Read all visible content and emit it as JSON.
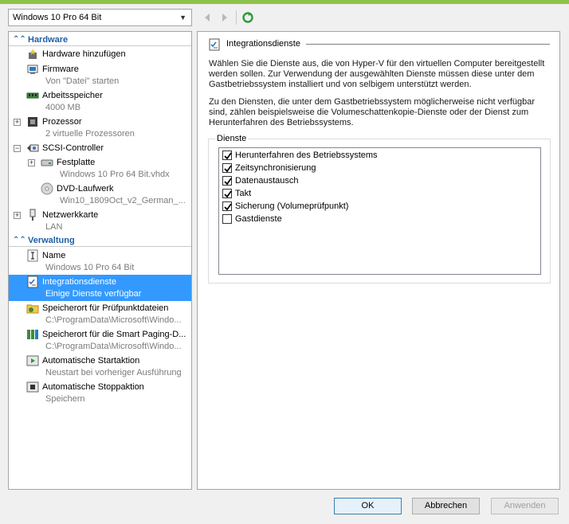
{
  "vm_selector": {
    "value": "Windows 10 Pro 64 Bit"
  },
  "toolbar": {
    "back_icon": "back-arrow-icon",
    "forward_icon": "forward-arrow-icon",
    "refresh_icon": "refresh-icon"
  },
  "sections": {
    "hardware": "Hardware",
    "management": "Verwaltung"
  },
  "hardware_items": [
    {
      "label": "Hardware hinzufügen",
      "sub": ""
    },
    {
      "label": "Firmware",
      "sub": "Von \"Datei\" starten"
    },
    {
      "label": "Arbeitsspeicher",
      "sub": "4000 MB"
    },
    {
      "label": "Prozessor",
      "sub": "2 virtuelle Prozessoren"
    },
    {
      "label": "SCSI-Controller",
      "sub": ""
    },
    {
      "label": "Festplatte",
      "sub": "Windows 10 Pro 64 Bit.vhdx"
    },
    {
      "label": "DVD-Laufwerk",
      "sub": "Win10_1809Oct_v2_German_..."
    },
    {
      "label": "Netzwerkkarte",
      "sub": "LAN"
    }
  ],
  "management_items": [
    {
      "label": "Name",
      "sub": "Windows 10 Pro 64 Bit"
    },
    {
      "label": "Integrationsdienste",
      "sub": "Einige Dienste verfügbar"
    },
    {
      "label": "Speicherort für Prüfpunktdateien",
      "sub": "C:\\ProgramData\\Microsoft\\Windo..."
    },
    {
      "label": "Speicherort für die Smart Paging-D...",
      "sub": "C:\\ProgramData\\Microsoft\\Windo..."
    },
    {
      "label": "Automatische Startaktion",
      "sub": "Neustart bei vorheriger Ausführung"
    },
    {
      "label": "Automatische Stoppaktion",
      "sub": "Speichern"
    }
  ],
  "content": {
    "title": "Integrationsdienste",
    "para1": "Wählen Sie die Dienste aus, die von Hyper-V für den virtuellen Computer bereitgestellt werden sollen. Zur Verwendung der ausgewählten Dienste müssen diese unter dem Gastbetriebssystem installiert und von selbigem unterstützt werden.",
    "para2": "Zu den Diensten, die unter dem Gastbetriebssystem möglicherweise nicht verfügbar sind, zählen beispielsweise die Volumeschattenkopie-Dienste oder der Dienst zum Herunterfahren des Betriebssystems.",
    "group_label": "Dienste",
    "services": [
      {
        "label": "Herunterfahren des Betriebssystems",
        "checked": true
      },
      {
        "label": "Zeitsynchronisierung",
        "checked": true
      },
      {
        "label": "Datenaustausch",
        "checked": true
      },
      {
        "label": "Takt",
        "checked": true
      },
      {
        "label": "Sicherung (Volumeprüfpunkt)",
        "checked": true
      },
      {
        "label": "Gastdienste",
        "checked": false
      }
    ]
  },
  "buttons": {
    "ok": "OK",
    "cancel": "Abbrechen",
    "apply": "Anwenden"
  },
  "colors": {
    "selection": "#3399ff",
    "section_header": "#1f5fa6",
    "top_strip": "#8fc24a"
  }
}
